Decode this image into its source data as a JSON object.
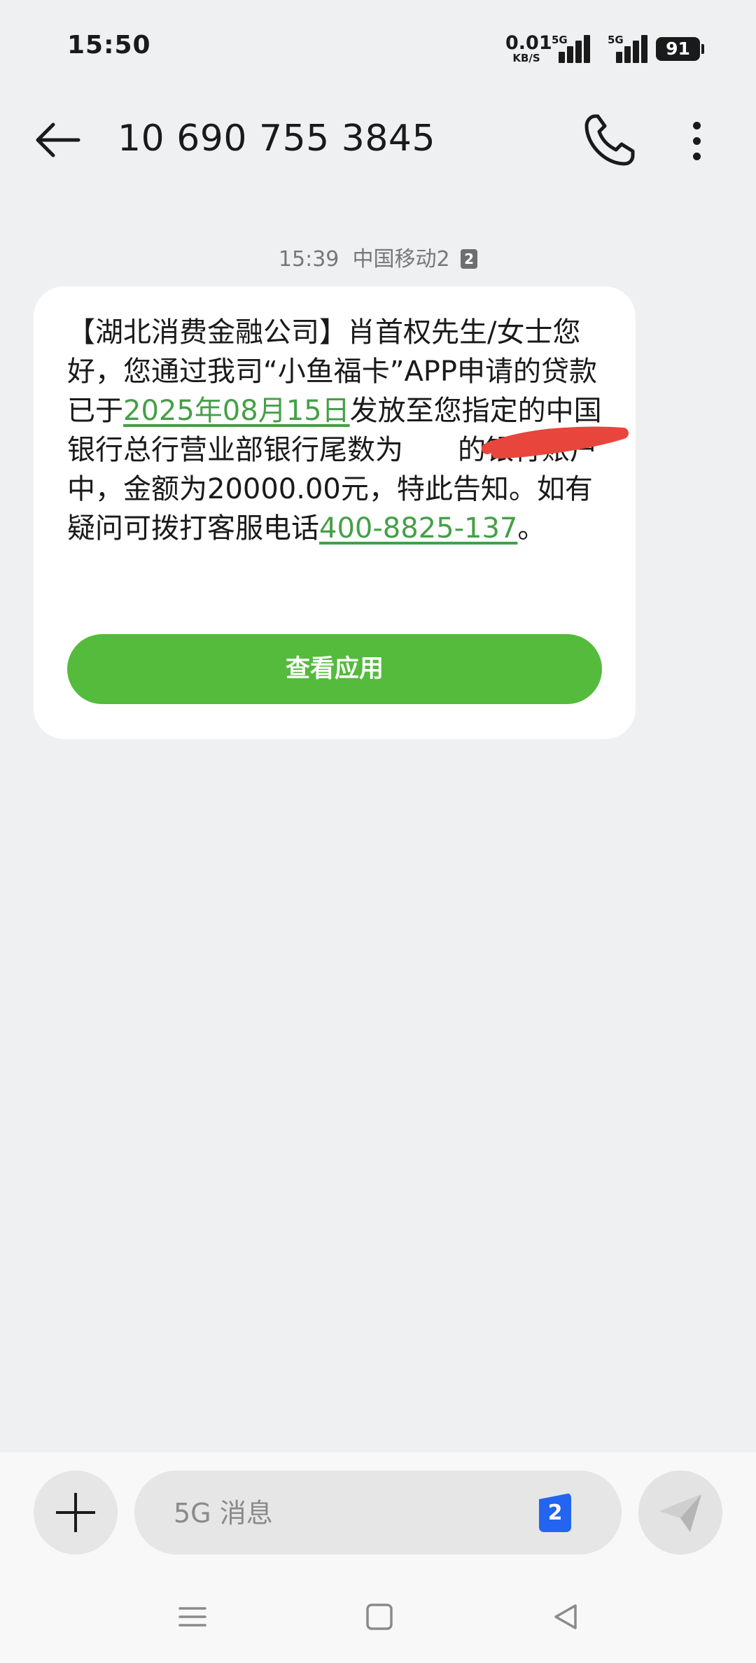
{
  "status_bar": {
    "time": "15:50",
    "net_speed_value": "0.01",
    "net_speed_unit": "KB/S",
    "sim1_network": "5G",
    "sim2_network": "5G",
    "battery": "91"
  },
  "header": {
    "contact": "10 690 755 3845",
    "back_icon": "arrow-left-icon",
    "call_icon": "phone-icon",
    "more_icon": "more-vertical-icon"
  },
  "message": {
    "time": "15:39",
    "carrier": "中国移动2",
    "sim_badge": "2",
    "body": {
      "part1": "【湖北消费金融公司】肖首权先生/女士您好，您通过我司“小鱼福卡”APP申请的贷款已于",
      "date_link": "2025年08月15日",
      "part2": "发放至您指定的中国银行总行营业部银行尾数为",
      "redacted": "",
      "part3": "的银行账户中，金额为20000.00元，特此告知。如有疑问可拨打客服电话",
      "phone_link": "400-8825-137",
      "part4": "。"
    },
    "button_label": "查看应用",
    "accent_color": "#54bb3c",
    "link_color": "#45a047"
  },
  "composer": {
    "placeholder": "5G 消息",
    "sim_selector": "2",
    "add_icon": "plus-icon",
    "send_icon": "send-icon"
  },
  "nav_bar": {
    "menu_icon": "menu-icon",
    "home_icon": "home-square-icon",
    "back_icon": "back-triangle-icon"
  }
}
